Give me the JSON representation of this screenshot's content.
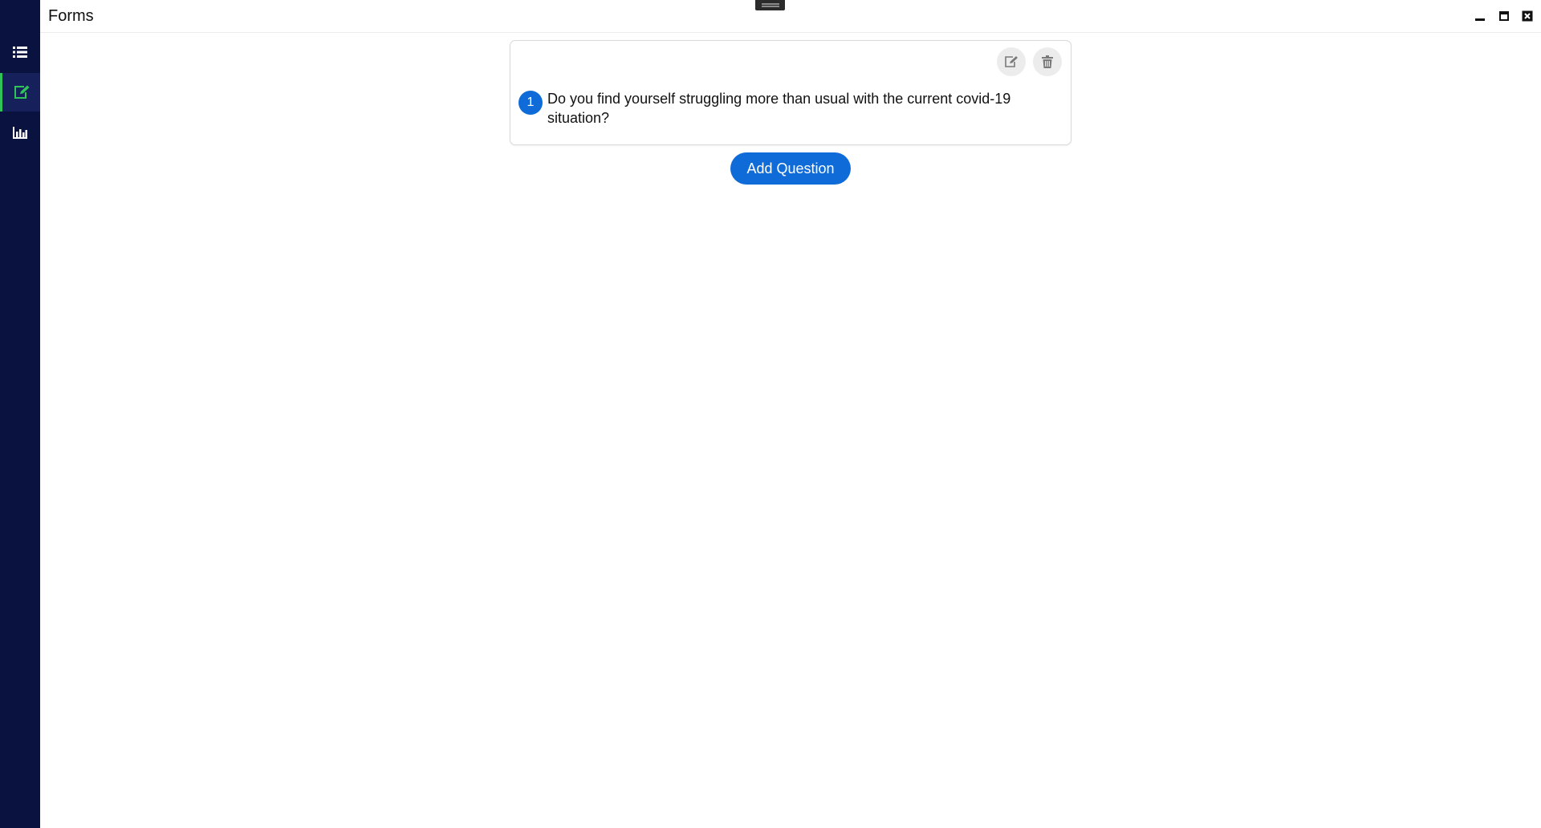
{
  "app": {
    "title": "Forms"
  },
  "sidebar": {
    "items": [
      {
        "name": "list",
        "icon": "list-icon",
        "active": false
      },
      {
        "name": "edit",
        "icon": "edit-icon",
        "active": true
      },
      {
        "name": "chart",
        "icon": "bar-chart-icon",
        "active": false
      }
    ]
  },
  "window_controls": {
    "minimize_icon": "minimize-icon",
    "maximize_icon": "maximize-icon",
    "close_icon": "close-icon"
  },
  "questions": [
    {
      "number": "1",
      "text": "Do you find yourself struggling more than usual with the current covid-19 situation?"
    }
  ],
  "actions": {
    "add_question_label": "Add Question"
  },
  "colors": {
    "sidebar_bg": "#0a1240",
    "active_indicator": "#2fc35a",
    "accent": "#0f6bd8"
  }
}
